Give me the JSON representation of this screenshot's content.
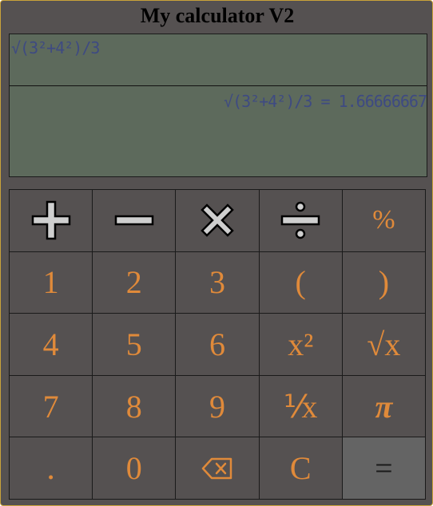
{
  "app": {
    "title": "My calculator V2"
  },
  "display": {
    "expression": "√(3²+4²)/3",
    "result": "√(3²+4²)/3 = 1.66666667"
  },
  "keys": {
    "percent": "%",
    "one": "1",
    "two": "2",
    "three": "3",
    "open_paren": "(",
    "close_paren": ")",
    "four": "4",
    "five": "5",
    "six": "6",
    "square": "x²",
    "sqrt": "√x",
    "seven": "7",
    "eight": "8",
    "nine": "9",
    "reciprocal": "⅟x",
    "pi": "π",
    "decimal": ".",
    "zero": "0",
    "clear": "C",
    "equals": "="
  },
  "icons": {
    "add": "plus-icon",
    "subtract": "minus-icon",
    "multiply": "times-icon",
    "divide": "divide-icon",
    "backspace": "backspace-icon"
  },
  "colors": {
    "key_text": "#e08a3a",
    "display_bg": "#5d6a5c",
    "display_text": "#3e4a82",
    "body_bg": "#555151",
    "equals_bg": "#646464"
  }
}
